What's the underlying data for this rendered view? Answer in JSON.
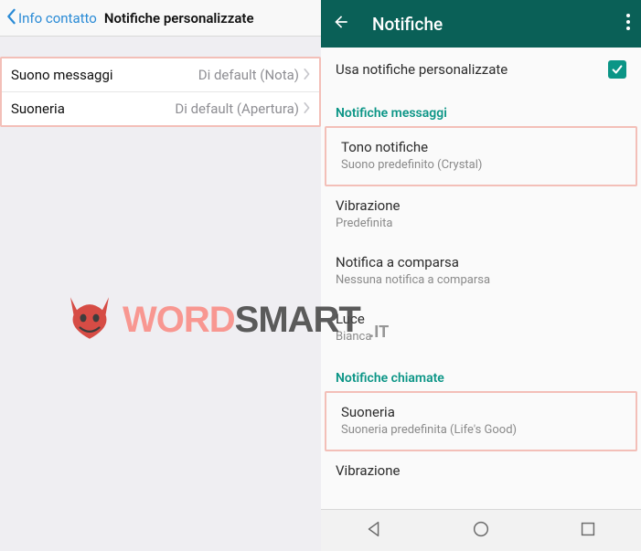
{
  "left": {
    "back_label": "Info contatto",
    "title": "Notifiche personalizzate",
    "rows": [
      {
        "label": "Suono messaggi",
        "value": "Di default (Nota)"
      },
      {
        "label": "Suoneria",
        "value": "Di default (Apertura)"
      }
    ]
  },
  "right": {
    "title": "Notifiche",
    "use_custom_label": "Usa notifiche personalizzate",
    "use_custom_checked": true,
    "section_messages": "Notifiche messaggi",
    "items_messages": [
      {
        "title": "Tono notifiche",
        "sub": "Suono predefinito (Crystal)"
      },
      {
        "title": "Vibrazione",
        "sub": "Predefinita"
      },
      {
        "title": "Notifica a comparsa",
        "sub": "Nessuna notifica a comparsa"
      },
      {
        "title": "Luce",
        "sub": "Bianca"
      }
    ],
    "section_calls": "Notifiche chiamate",
    "items_calls": [
      {
        "title": "Suoneria",
        "sub": "Suoneria predefinita  (Life's Good)"
      },
      {
        "title": "Vibrazione",
        "sub": ""
      }
    ]
  },
  "watermark": {
    "word": "WORD",
    "smart": "SMART",
    "suffix": ".IT"
  }
}
